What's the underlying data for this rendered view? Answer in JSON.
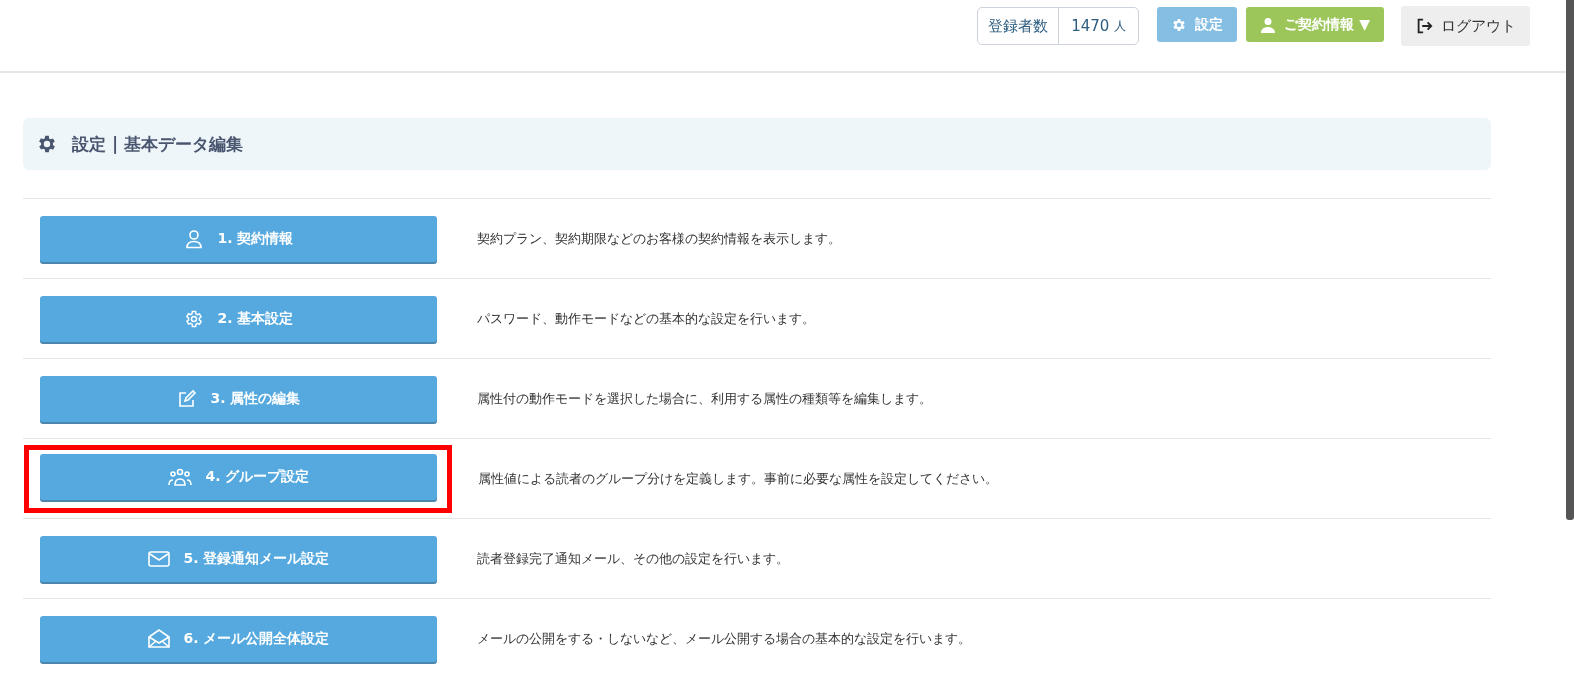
{
  "header": {
    "registrants": {
      "label": "登録者数",
      "count": "1470",
      "unit": "人"
    },
    "settings_button": "設定",
    "contract_button": {
      "label": "ご契約情報",
      "caret": "▼"
    },
    "logout_button": "ログアウト"
  },
  "page_title": "設定 | 基本データ編集",
  "items": [
    {
      "kind": "user",
      "label": "1. 契約情報",
      "description": "契約プラン、契約期限などのお客様の契約情報を表示します。",
      "highlighted": false
    },
    {
      "kind": "gear",
      "label": "2. 基本設定",
      "description": "パスワード、動作モードなどの基本的な設定を行います。",
      "highlighted": false
    },
    {
      "kind": "edit",
      "label": "3. 属性の編集",
      "description": "属性付の動作モードを選択した場合に、利用する属性の種類等を編集します。",
      "highlighted": false
    },
    {
      "kind": "group",
      "label": "4. グループ設定",
      "description": "属性値による読者のグループ分けを定義します。事前に必要な属性を設定してください。",
      "highlighted": true
    },
    {
      "kind": "mail",
      "label": "5. 登録通知メール設定",
      "description": "読者登録完了通知メール、その他の設定を行います。",
      "highlighted": false
    },
    {
      "kind": "mail-open",
      "label": "6. メール公開全体設定",
      "description": "メールの公開をする・しないなど、メール公開する場合の基本的な設定を行います。",
      "highlighted": false
    }
  ]
}
